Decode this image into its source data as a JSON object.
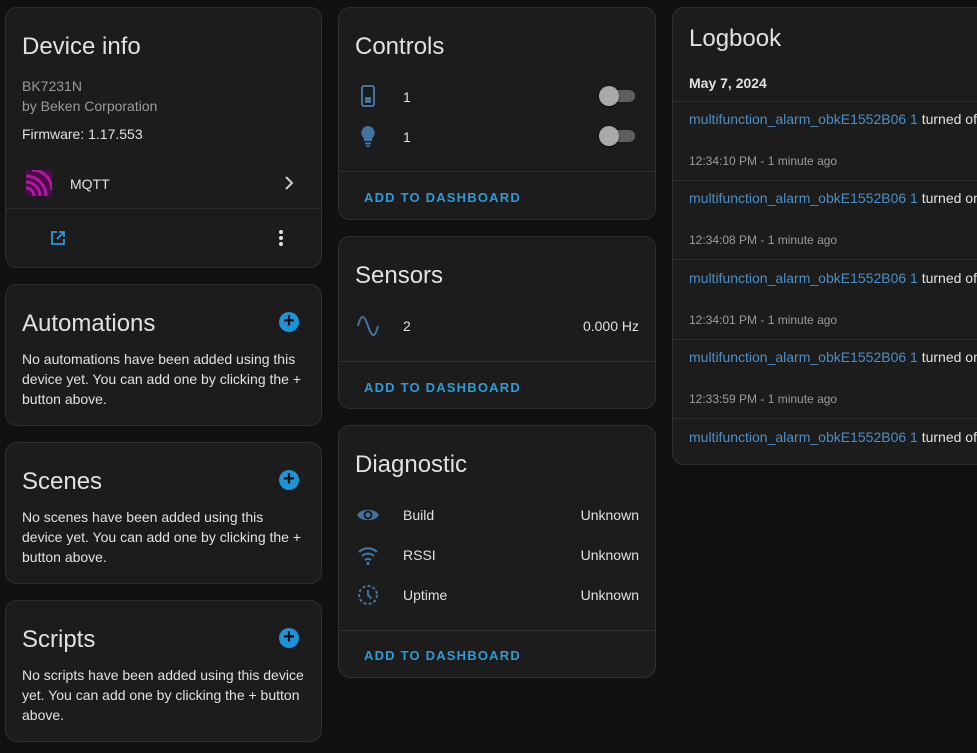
{
  "device_info": {
    "title": "Device info",
    "model": "BK7231N",
    "manufacturer": "by Beken Corporation",
    "firmware": "Firmware: 1.17.553",
    "integration": "MQTT"
  },
  "automations": {
    "title": "Automations",
    "text": "No automations have been added using this device yet. You can add one by clicking the + button above."
  },
  "scenes": {
    "title": "Scenes",
    "text": "No scenes have been added using this device yet. You can add one by clicking the + button above."
  },
  "scripts": {
    "title": "Scripts",
    "text": "No scripts have been added using this device yet. You can add one by clicking the + button above."
  },
  "controls": {
    "title": "Controls",
    "items": [
      {
        "icon": "switch-icon",
        "label": "1",
        "state": "off"
      },
      {
        "icon": "lightbulb-icon",
        "label": "1",
        "state": "off"
      }
    ],
    "add_label": "ADD TO DASHBOARD"
  },
  "sensors": {
    "title": "Sensors",
    "items": [
      {
        "icon": "sine-wave-icon",
        "label": "2",
        "value": "0.000 Hz"
      }
    ],
    "add_label": "ADD TO DASHBOARD"
  },
  "diagnostic": {
    "title": "Diagnostic",
    "items": [
      {
        "icon": "eye-icon",
        "label": "Build",
        "value": "Unknown"
      },
      {
        "icon": "wifi-icon",
        "label": "RSSI",
        "value": "Unknown"
      },
      {
        "icon": "timer-icon",
        "label": "Uptime",
        "value": "Unknown"
      }
    ],
    "add_label": "ADD TO DASHBOARD"
  },
  "logbook": {
    "title": "Logbook",
    "date": "May 7, 2024",
    "entries": [
      {
        "entity": "multifunction_alarm_obkE1552B06 1",
        "action": "turned off",
        "time": "12:34:10 PM - 1 minute ago"
      },
      {
        "entity": "multifunction_alarm_obkE1552B06 1",
        "action": "turned on",
        "time": "12:34:08 PM - 1 minute ago"
      },
      {
        "entity": "multifunction_alarm_obkE1552B06 1",
        "action": "turned off",
        "time": "12:34:01 PM - 1 minute ago"
      },
      {
        "entity": "multifunction_alarm_obkE1552B06 1",
        "action": "turned on",
        "time": "12:33:59 PM - 1 minute ago"
      },
      {
        "entity": "multifunction_alarm_obkE1552B06 1",
        "action": "turned off",
        "time": ""
      }
    ]
  },
  "colors": {
    "accent": "#2d9bd8",
    "mqtt": "#660066",
    "background": "#111111",
    "card": "#1c1c1c"
  }
}
